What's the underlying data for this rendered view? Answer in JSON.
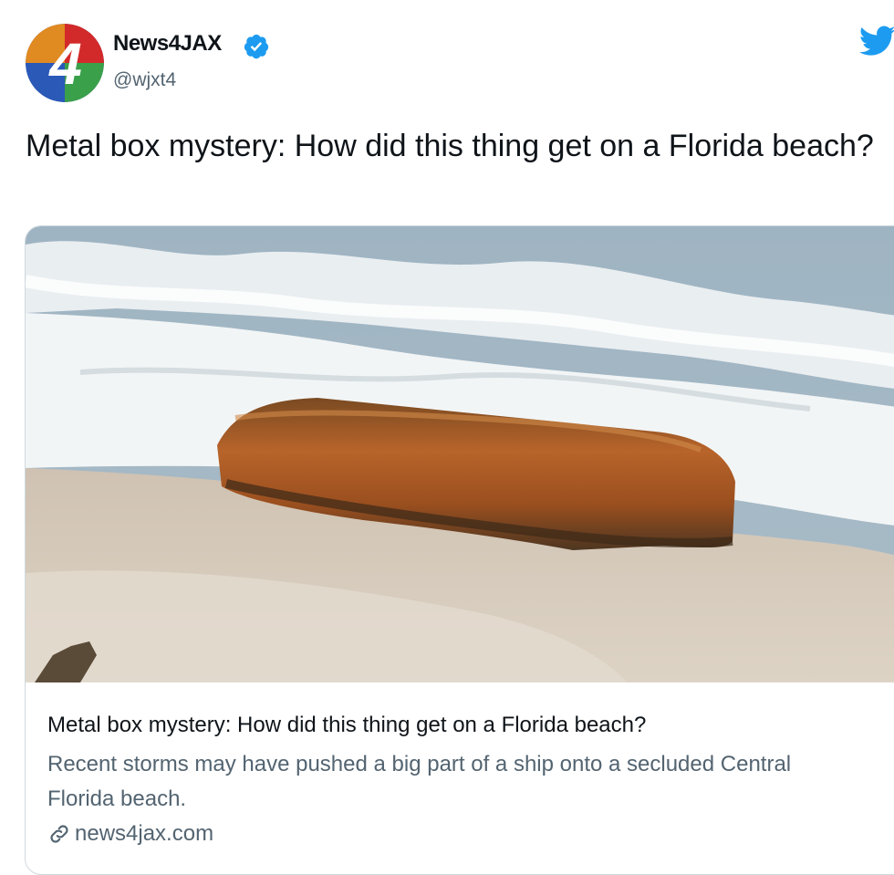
{
  "colors": {
    "verified_blue": "#1d9bf0",
    "twitter_blue": "#1d9bf0",
    "text_primary": "#0f1419",
    "text_secondary": "#536471",
    "card_border": "#cfd9de"
  },
  "author": {
    "avatar_text": "4",
    "display_name": "News4JAX",
    "handle": "@wjxt4",
    "verified_icon": "verified-badge-icon"
  },
  "platform_icon": "twitter-bird-icon",
  "tweet": {
    "text": "Metal box mystery: How did this thing get on a Florida beach?"
  },
  "card": {
    "image_description_icon": "beach-photo",
    "title": "Metal box mystery: How did this thing get on a Florida beach?",
    "description": "Recent storms may have pushed a big part of a ship onto a secluded Central Florida beach.",
    "domain": "news4jax.com",
    "link_icon": "link-icon"
  }
}
